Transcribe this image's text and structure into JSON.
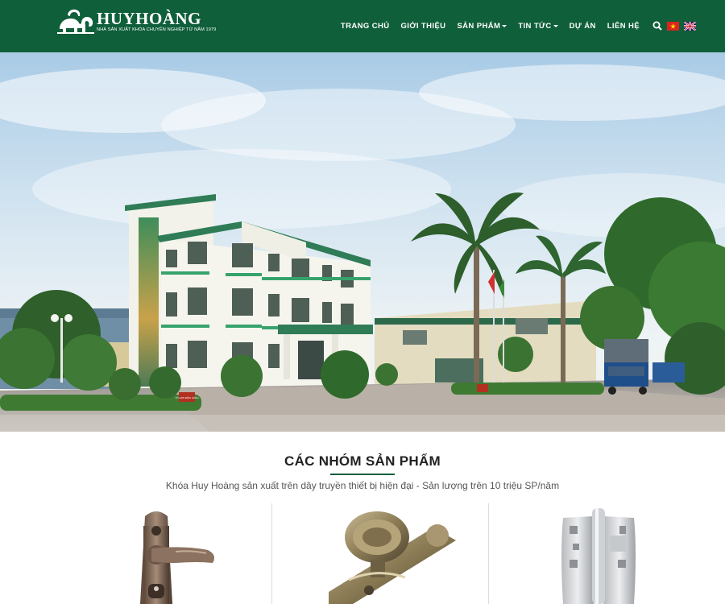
{
  "header": {
    "logo": {
      "brand": "HUYHOÀNG",
      "tagline": "NHÀ SẢN XUẤT KHÓA CHUYÊN NGHIỆP TỪ NĂM 1979"
    },
    "nav": [
      {
        "label": "TRANG CHỦ",
        "dropdown": false
      },
      {
        "label": "GIỚI THIỆU",
        "dropdown": false
      },
      {
        "label": "SẢN PHẨM",
        "dropdown": true
      },
      {
        "label": "TIN TỨC",
        "dropdown": true
      },
      {
        "label": "DỰ ÁN",
        "dropdown": false
      },
      {
        "label": "LIÊN HỆ",
        "dropdown": false
      }
    ],
    "search_icon": "search-icon",
    "languages": [
      "vi",
      "en"
    ]
  },
  "hero": {
    "sign_label": "TỔ HỢP ĐIỀU HÀNH"
  },
  "products_section": {
    "title": "CÁC NHÓM SẢN PHẨM",
    "subtitle": "Khóa Huy Hoàng sản xuất trên dây truyền thiết bị hiện đại - Sản lượng trên 10 triệu SP/năm",
    "items": [
      {
        "image": "lever-door-handle-lock"
      },
      {
        "image": "ornate-knob-lock"
      },
      {
        "image": "stainless-hinge"
      }
    ]
  },
  "colors": {
    "header_bg": "#0f5f3a",
    "accent": "#0f5f3a",
    "text": "#222222"
  }
}
